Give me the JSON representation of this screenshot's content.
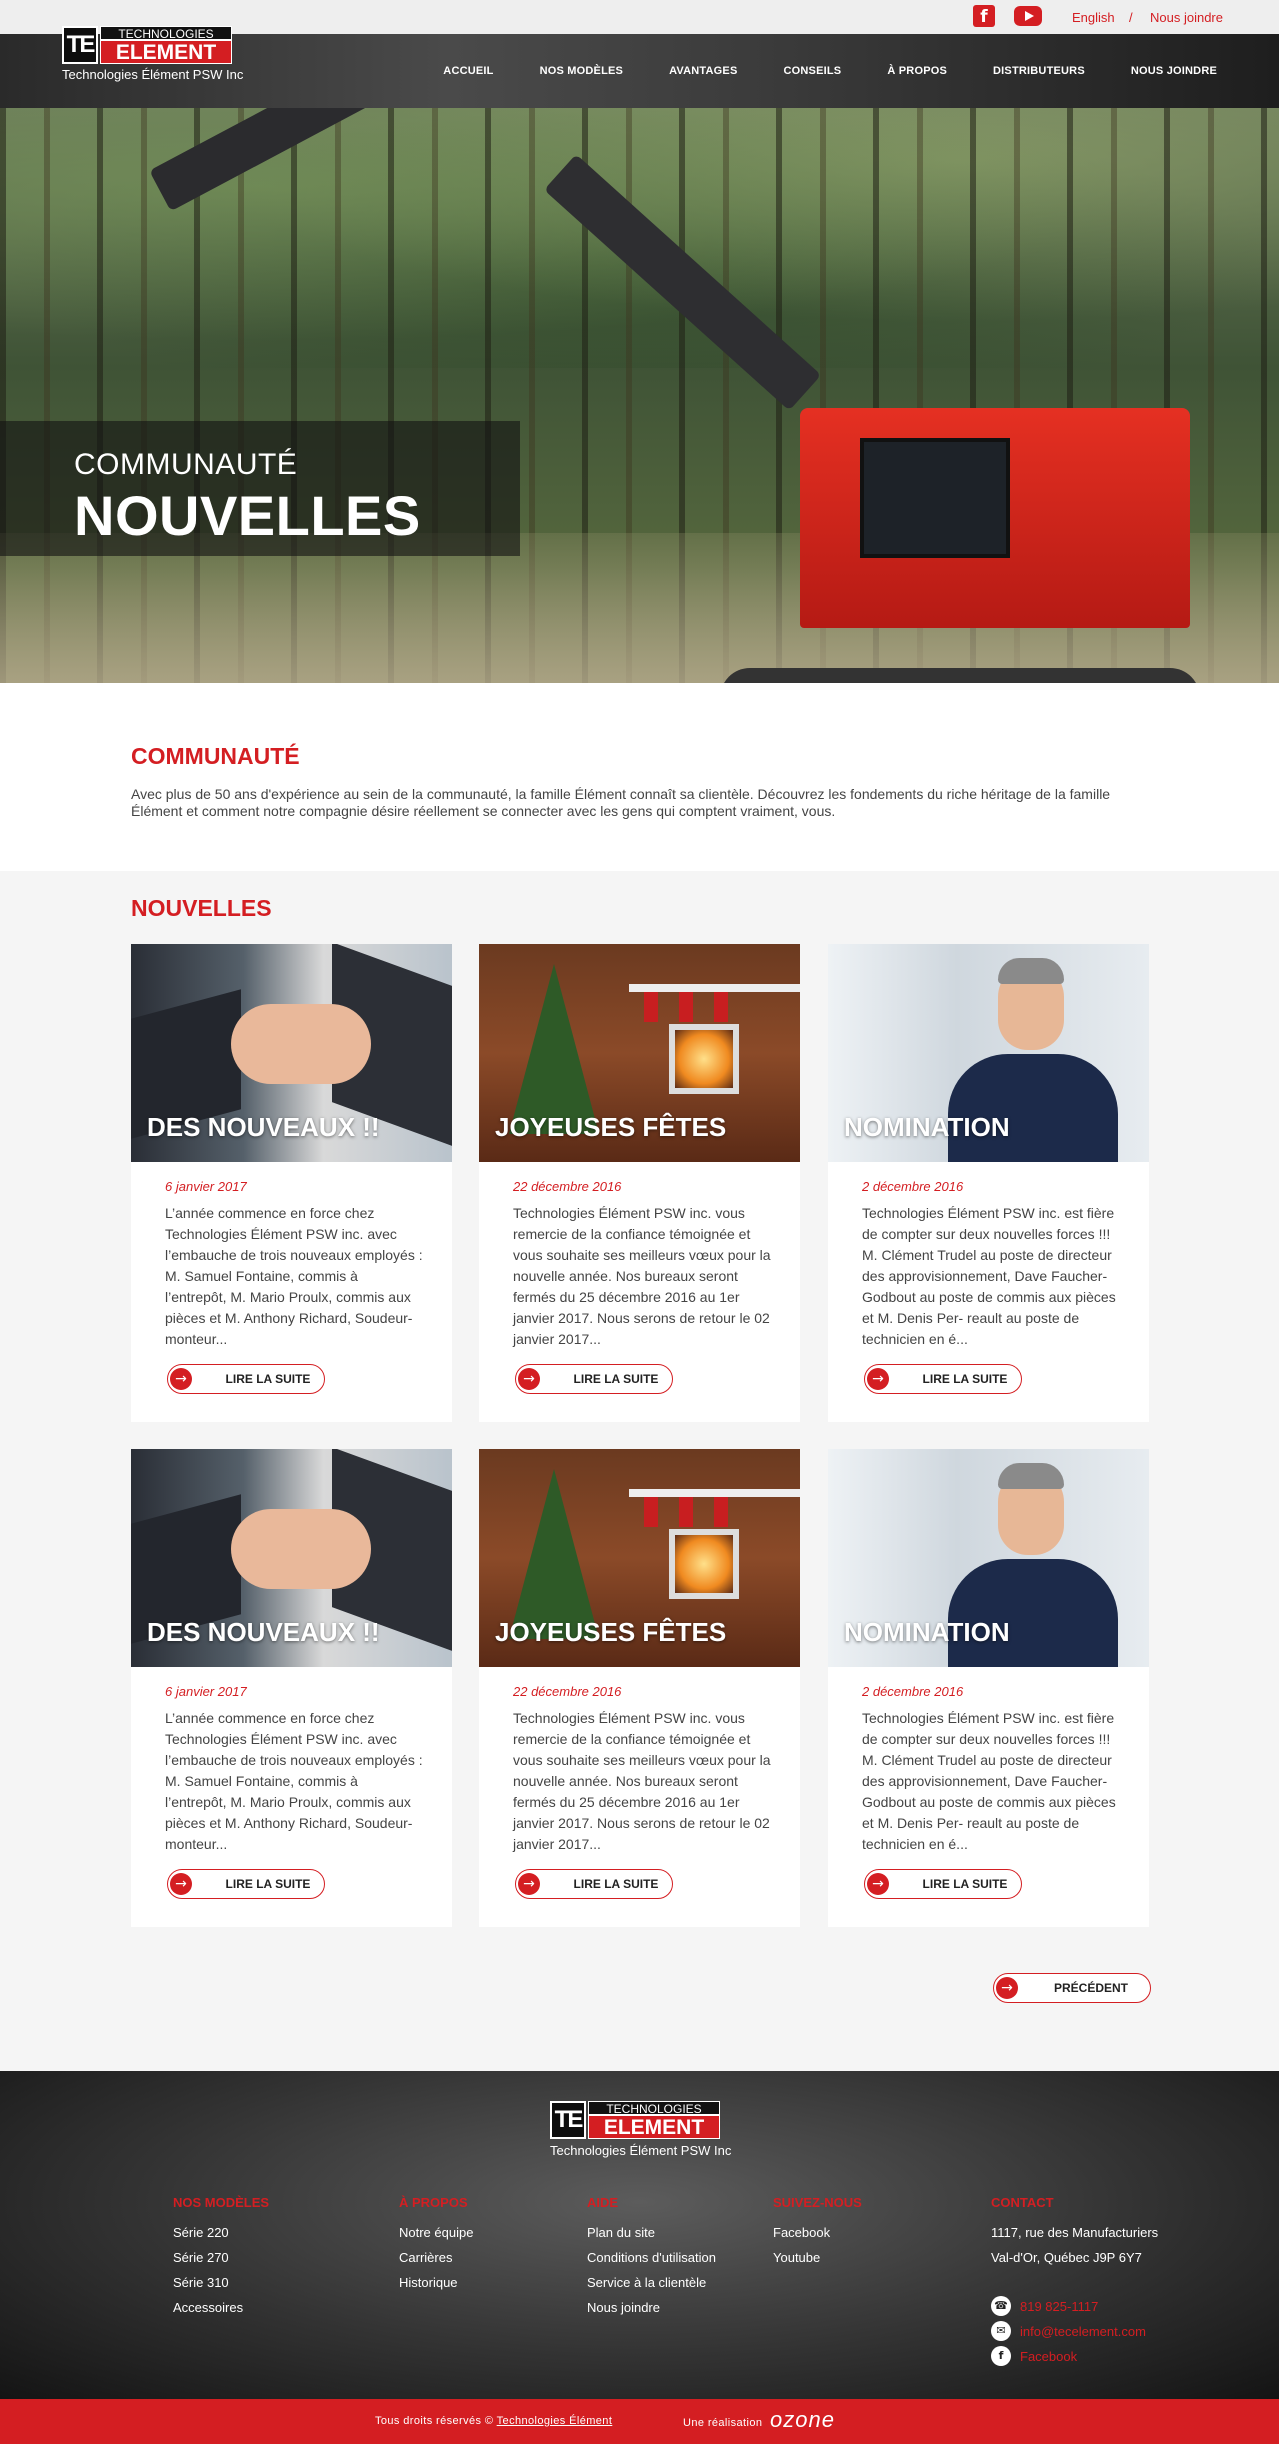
{
  "topbar": {
    "facebook_icon": "facebook-icon",
    "youtube_icon": "youtube-icon",
    "language": "English",
    "separator": "/",
    "contact": "Nous joindre"
  },
  "brand": {
    "logo_mark": "TE",
    "logo_top": "TECHNOLOGIES",
    "logo_main": "ELEMENT",
    "logo_sub": "Technologies Élément PSW Inc",
    "accent": "#d41e22"
  },
  "nav": {
    "items": [
      "ACCUEIL",
      "NOS MODÈLES",
      "AVANTAGES",
      "CONSEILS",
      "À PROPOS",
      "DISTRIBUTEURS",
      "NOUS JOINDRE"
    ]
  },
  "hero": {
    "kicker": "COMMUNAUTÉ",
    "title": "NOUVELLES"
  },
  "intro": {
    "heading": "COMMUNAUTÉ",
    "text": "Avec plus de 50 ans d'expérience au sein de la communauté, la famille Élément connaît sa clientèle. Découvrez les fondements du riche héritage de la famille Élément et comment notre compagnie désire réellement se connecter avec les gens qui comptent vraiment, vous."
  },
  "news": {
    "heading": "NOUVELLES",
    "read_more": "LIRE LA SUITE",
    "previous": "PRÉCÉDENT",
    "cards": [
      {
        "title": "DES NOUVEAUX !!",
        "date": "6 janvier 2017",
        "text": "L’année commence en force chez Technologies Élément PSW inc. avec l’embauche de trois nouveaux employés : M. Samuel Fontaine, commis à l’entrepôt, M. Mario Proulx, commis aux pièces et M. Anthony Richard, Soudeur-monteur..."
      },
      {
        "title": "JOYEUSES FÊTES",
        "date": "22 décembre 2016",
        "text": "Technologies Élément PSW inc. vous remercie de la confiance témoignée et vous souhaite ses meilleurs vœux pour la nouvelle année. Nos bureaux seront fermés du 25 décembre 2016 au 1er janvier 2017. Nous serons de retour le 02 janvier 2017..."
      },
      {
        "title": "NOMINATION",
        "date": "2 décembre 2016",
        "text": "Technologies Élément PSW inc. est fière de compter sur deux nouvelles forces !!! M. Clément Trudel au poste de directeur des approvisionnement, Dave Faucher-Godbout au poste de commis aux pièces et M. Denis Per- reault au poste de technicien en é..."
      },
      {
        "title": "DES NOUVEAUX !!",
        "date": "6 janvier 2017",
        "text": "L’année commence en force chez Technologies Élément PSW inc. avec l’embauche de trois nouveaux employés : M. Samuel Fontaine, commis à l’entrepôt, M. Mario Proulx, commis aux pièces et M. Anthony Richard, Soudeur-monteur..."
      },
      {
        "title": "JOYEUSES FÊTES",
        "date": "22 décembre 2016",
        "text": "Technologies Élément PSW inc. vous remercie de la confiance témoignée et vous souhaite ses meilleurs vœux pour la nouvelle année. Nos bureaux seront fermés du 25 décembre 2016 au 1er janvier 2017. Nous serons de retour le 02 janvier 2017..."
      },
      {
        "title": "NOMINATION",
        "date": "2 décembre 2016",
        "text": "Technologies Élément PSW inc. est fière de compter sur deux nouvelles forces !!! M. Clément Trudel au poste de directeur des approvisionnement, Dave Faucher-Godbout au poste de commis aux pièces et M. Denis Per- reault au poste de technicien en é..."
      }
    ]
  },
  "footer": {
    "models": {
      "heading": "NOS MODÈLES",
      "items": [
        "Série 220",
        "Série 270",
        "Série 310",
        "Accessoires"
      ]
    },
    "about": {
      "heading": "À PROPOS",
      "items": [
        "Notre équipe",
        "Carrières",
        "Historique"
      ]
    },
    "help": {
      "heading": "AIDE",
      "items": [
        "Plan du site",
        "Conditions d'utilisation",
        "Service à la clientèle",
        "Nous joindre"
      ]
    },
    "follow": {
      "heading": "SUIVEZ-NOUS",
      "items": [
        "Facebook",
        "Youtube"
      ]
    },
    "contact": {
      "heading": "CONTACT",
      "address1": "1117, rue des Manufacturiers",
      "address2": "Val-d'Or, Québec  J9P 6Y7",
      "phone": "819 825-1117",
      "email": "info@tecelement.com",
      "facebook": "Facebook"
    }
  },
  "bottom": {
    "rights": "Tous droits réservés ©",
    "rights_link": "Technologies Élément",
    "realisation": "Une réalisation",
    "agency": "ozone"
  }
}
